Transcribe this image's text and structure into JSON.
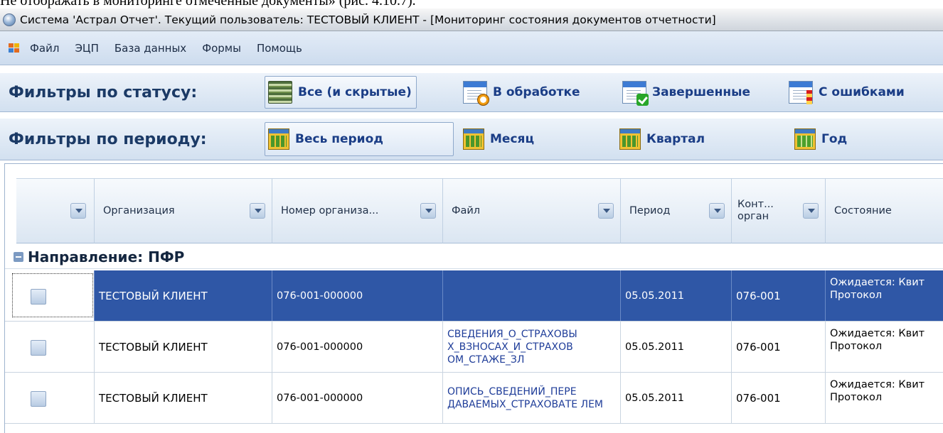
{
  "doc_caption": "Не отображать в мониторинге отмеченные документы» (рис. 4.10.7).",
  "window": {
    "title": "Система 'Астрал Отчет'. Текущий пользователь: ТЕСТОВЫЙ КЛИЕНТ - [Мониторинг состояния документов отчетности]"
  },
  "menu": {
    "items": [
      "Файл",
      "ЭЦП",
      "База данных",
      "Формы",
      "Помощь"
    ]
  },
  "status_filters": {
    "label": "Фильтры по статусу:",
    "buttons": [
      {
        "label": "Все (и скрытые)",
        "icon": "document-stack-icon",
        "active": true
      },
      {
        "label": "В обработке",
        "icon": "document-clock-icon",
        "active": false
      },
      {
        "label": "Завершенные",
        "icon": "document-check-icon",
        "active": false
      },
      {
        "label": "С ошибками",
        "icon": "document-error-icon",
        "active": false
      }
    ]
  },
  "period_filters": {
    "label": "Фильтры по периоду:",
    "buttons": [
      {
        "label": "Весь период",
        "icon": "calendar-icon",
        "active": true
      },
      {
        "label": "Месяц",
        "icon": "calendar-icon",
        "active": false
      },
      {
        "label": "Квартал",
        "icon": "calendar-icon",
        "active": false
      },
      {
        "label": "Год",
        "icon": "calendar-green-icon",
        "active": false
      }
    ]
  },
  "grid": {
    "columns": [
      "",
      "Организация",
      "Номер организа...",
      "Файл",
      "Период",
      "Конт... орган",
      "Состояние"
    ],
    "group": "Направление: ПФР",
    "rows": [
      {
        "selected": true,
        "org": "ТЕСТОВЫЙ КЛИЕНТ",
        "number": "076-001-000000",
        "file": "",
        "period": "05.05.2011",
        "control": "076-001",
        "state": "Ожидается: Квит Протокол"
      },
      {
        "selected": false,
        "org": "ТЕСТОВЫЙ КЛИЕНТ",
        "number": "076-001-000000",
        "file": "СВЕДЕНИЯ_О_СТРАХОВЫ Х_ВЗНОСАХ_И_СТРАХОВ ОМ_СТАЖЕ_ЗЛ",
        "period": "05.05.2011",
        "control": "076-001",
        "state": "Ожидается: Квит Протокол"
      },
      {
        "selected": false,
        "org": "ТЕСТОВЫЙ КЛИЕНТ",
        "number": "076-001-000000",
        "file": "ОПИСЬ_СВЕДЕНИЙ_ПЕРЕ ДАВАЕМЫХ_СТРАХОВАТЕ ЛЕМ",
        "period": "05.05.2011",
        "control": "076-001",
        "state": "Ожидается: Квит Протокол"
      }
    ]
  },
  "colors": {
    "selection": "#2f57a6",
    "filter_text": "#1a3d86",
    "link_text": "#1f3d99"
  }
}
